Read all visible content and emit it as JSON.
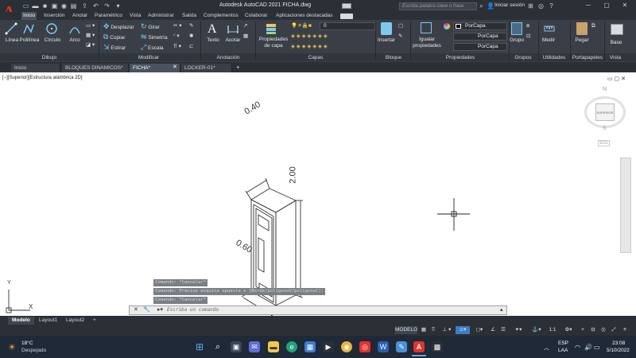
{
  "title_bar": {
    "title": "Autodesk AutoCAD 2021   FICHA.dwg",
    "search_placeholder": "Escriba palabra clave o frase",
    "signin": "Iniciar sesión"
  },
  "ribbon_tabs": [
    "Inicio",
    "Inserción",
    "Anotar",
    "Paramétrico",
    "Vista",
    "Administrar",
    "Salida",
    "Complementos",
    "Colaborar",
    "Aplicaciones destacadas"
  ],
  "ribbon": {
    "dibujo": {
      "linea": "Línea",
      "polilinea": "Polilínea",
      "circulo": "Círculo",
      "arco": "Arco"
    },
    "modificar": {
      "desplazar": "Desplazar",
      "girar": "Girar",
      "copiar": "Copiar",
      "simetria": "Simetría",
      "estirar": "Estirar",
      "escala": "Escala"
    },
    "anotacion": {
      "texto": "Texto",
      "acotar": "Acotar"
    },
    "capas": {
      "propiedades": "Propiedades de capa",
      "current_layer": "0"
    },
    "bloque": {
      "insertar": "Insertar"
    },
    "propiedades": {
      "igualar": "Igualar propiedades",
      "color": "PorCapa",
      "linetype": "PorCapa",
      "lineweight": "PorCapa"
    },
    "grupos": {
      "grupo": "Grupo"
    },
    "utilidades": {
      "medir": "Medir"
    },
    "portapapeles": {
      "pegar": "Pegar"
    },
    "vista": {
      "base": "Base"
    },
    "panel_labels": [
      "Dibujo",
      "Modificar",
      "Anotación",
      "Capas",
      "Bloque",
      "Propiedades",
      "Grupos",
      "Utilidades",
      "Portapapeles",
      "Vista"
    ]
  },
  "doc_tabs": [
    "Inicio",
    "BLOQUES DINAMICOS*",
    "FICHA*",
    "LOCKER-01*"
  ],
  "viewport_label": "[−][Superior][Estructura alámbrica 2D]",
  "drawing": {
    "dim_width": "0.40",
    "dim_height": "2.00",
    "dim_depth": "0.60"
  },
  "viewcube": {
    "top": "SUPERIOR",
    "n": "N",
    "s": "S",
    "wcs": "SCU"
  },
  "ucs": {
    "x": "X",
    "y": "Y"
  },
  "command": {
    "history": [
      "Comando: *Cancelar*",
      "Comando: Precise esquina opuesta o [Borde/polígonoV/polígonoC]:",
      "Comando: *Cancelar*"
    ],
    "placeholder": "Escriba un comando"
  },
  "layout_tabs": [
    "Modelo",
    "Layout1",
    "Layout2"
  ],
  "status": {
    "model": "MODELO",
    "scale": "1:1"
  },
  "taskbar": {
    "weather_temp": "18°C",
    "weather_desc": "Despejado",
    "lang": "ESP",
    "lang2": "LAA",
    "time": "23:08",
    "date": "5/10/2022"
  },
  "colors": {
    "autocad_red": "#e8312a",
    "ribbon_bg": "#3a3f47",
    "titlebar_bg": "#2b2f36"
  }
}
